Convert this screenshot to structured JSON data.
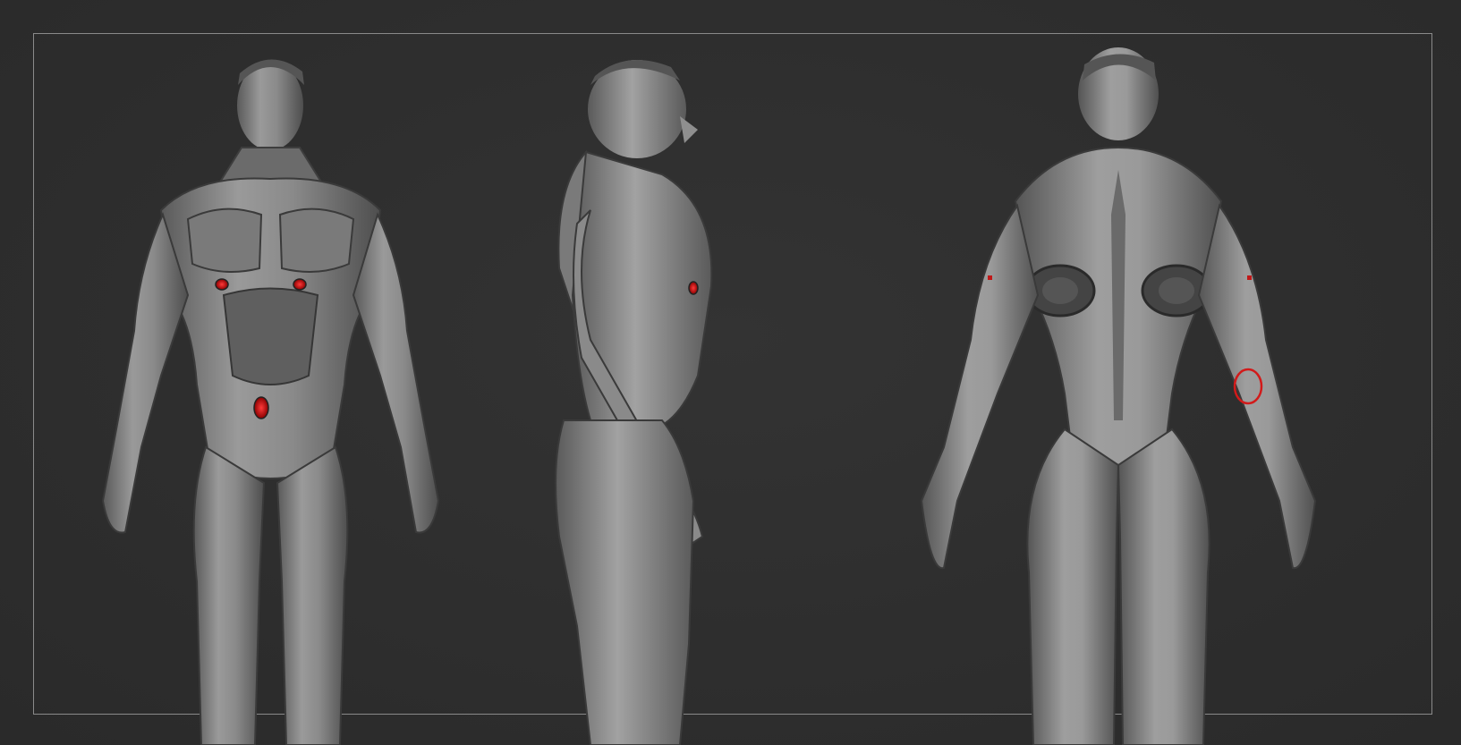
{
  "scene": {
    "background_color": "#2c2c2c",
    "frame_color": "#8a8a8a",
    "material_color": "#8c8c8c",
    "highlight_color": "#b5b5b5",
    "shadow_color": "#4a4a4a",
    "accent_color": "#c01818"
  },
  "views": [
    {
      "name": "front",
      "icon": "figure-front-icon"
    },
    {
      "name": "side",
      "icon": "figure-side-icon"
    },
    {
      "name": "back",
      "icon": "figure-back-icon"
    }
  ]
}
